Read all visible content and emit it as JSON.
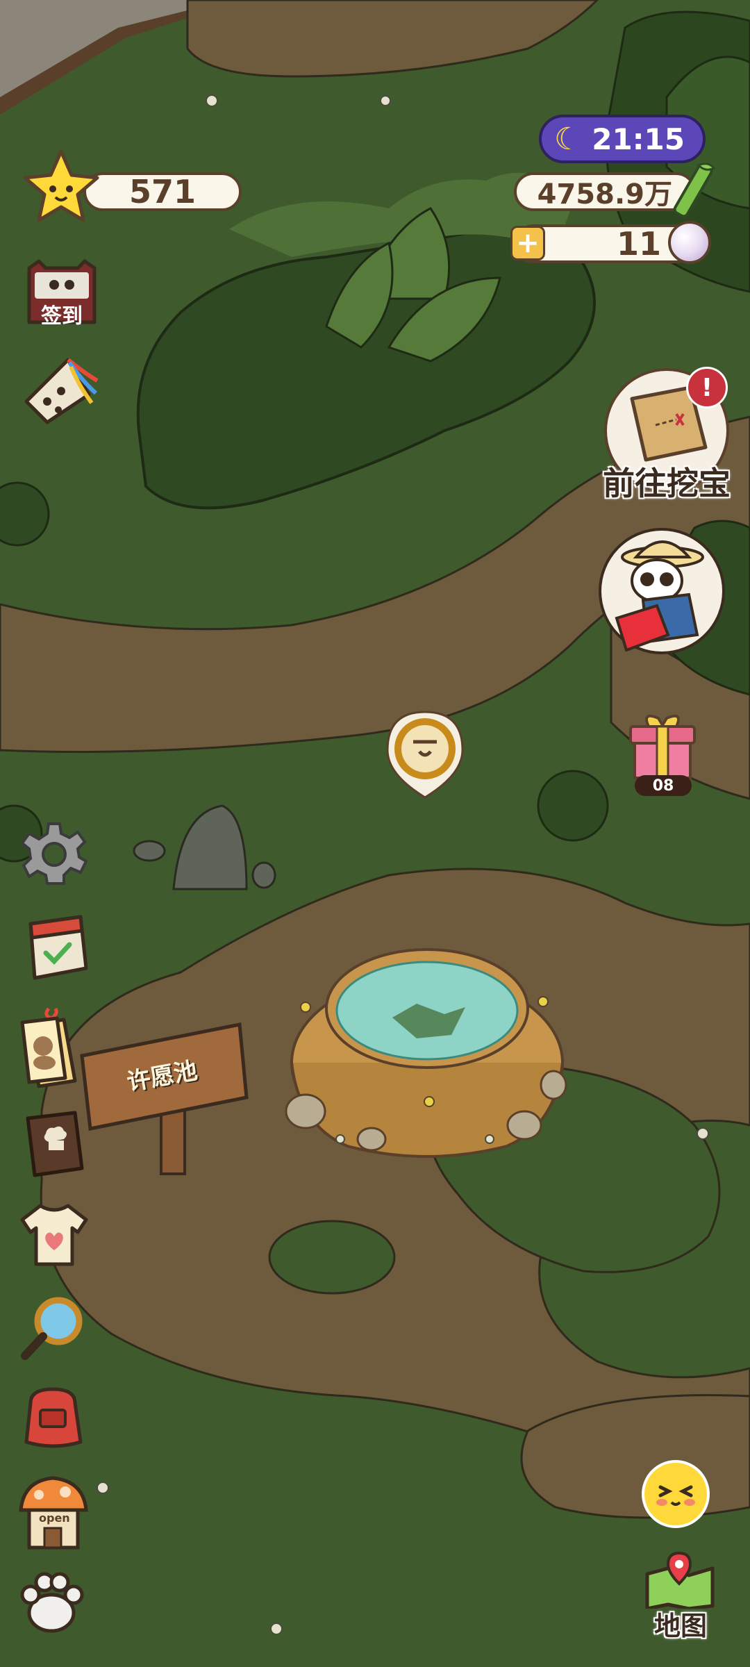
{
  "hud": {
    "stars": "571",
    "time": "21:15",
    "bamboo": "4758.9万",
    "pearls": "11",
    "gift_count": "08"
  },
  "buttons": {
    "sign_in_label": "签到",
    "treasure_label": "前往挖宝",
    "map_label": "地图",
    "shop_sign": "open"
  },
  "scene": {
    "wishing_pool_sign": "许愿池"
  },
  "icons": [
    "star-icon",
    "moon-icon",
    "bamboo-icon",
    "pearl-icon",
    "plus-icon",
    "sign-in-icon",
    "kite-icon",
    "settings-gear-icon",
    "calendar-book-icon",
    "pet-tag-icon",
    "recipe-book-icon",
    "tshirt-icon",
    "magnifier-icon",
    "backpack-icon",
    "shop-house-icon",
    "paw-icon",
    "treasure-map-icon",
    "explorer-panda-icon",
    "gift-box-icon",
    "emoji-face-icon",
    "map-icon"
  ],
  "colors": {
    "grass": "#3f5a2c",
    "path": "#6e5a3c",
    "time_pill": "#5b47b8",
    "alert": "#c8323c"
  }
}
